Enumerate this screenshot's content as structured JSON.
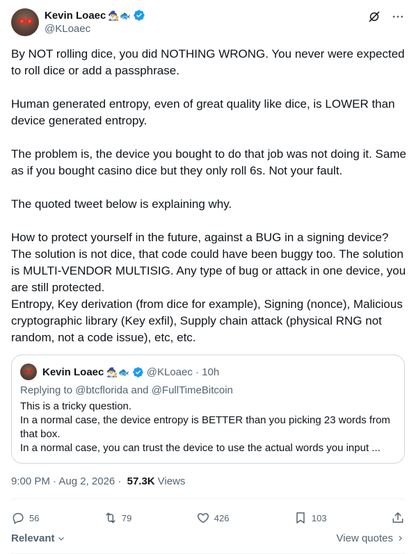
{
  "author": {
    "display_name": "Kevin Loaec",
    "emoji": "🧙‍♂️🐟",
    "handle": "@KLoaec"
  },
  "tweet": {
    "paragraphs": [
      "By NOT rolling dice, you did NOTHING WRONG. You never were expected to roll dice or add a passphrase.",
      "Human generated entropy, even of great quality like dice, is LOWER than device generated entropy.",
      "The problem is, the device you bought to do that job was not doing it. Same as if you bought casino dice but they only roll 6s. Not your fault.",
      "The quoted tweet below is explaining why.",
      "How to protect yourself in the future, against a BUG in a signing device? The solution is not dice, that code could have been buggy too. The solution is MULTI-VENDOR MULTISIG. Any type of bug or attack in one device, you are still protected.\nEntropy, Key derivation (from dice for example), Signing (nonce), Malicious cryptographic library (Key exfil), Supply chain attack (physical RNG not random, not a code issue), etc, etc."
    ]
  },
  "quote": {
    "display_name": "Kevin Loaec",
    "emoji": "🧙‍♂️🐟",
    "handle_time": "@KLoaec · 10h",
    "replying_prefix": "Replying to ",
    "replying_to_1": "@btcflorida",
    "replying_and": " and ",
    "replying_to_2": "@FullTimeBitcoin",
    "lines": [
      "This is a tricky question.",
      "In a normal case, the device entropy is BETTER than you picking 23 words from that box.",
      "In a normal case, you can trust the device to use the actual words you input ..."
    ]
  },
  "meta": {
    "timestamp": "9:00 PM · Aug 2, 2026 · ",
    "views_count": "57.3K",
    "views_label": "Views"
  },
  "actions": {
    "replies": "56",
    "reposts": "79",
    "likes": "426",
    "bookmarks": "103"
  },
  "footer": {
    "sort_label": "Relevant",
    "view_quotes": "View quotes"
  },
  "colors": {
    "verified": "#1d9bf0",
    "secondary_text": "#536471",
    "primary_text": "#0f1419",
    "border": "#cfd9de"
  }
}
